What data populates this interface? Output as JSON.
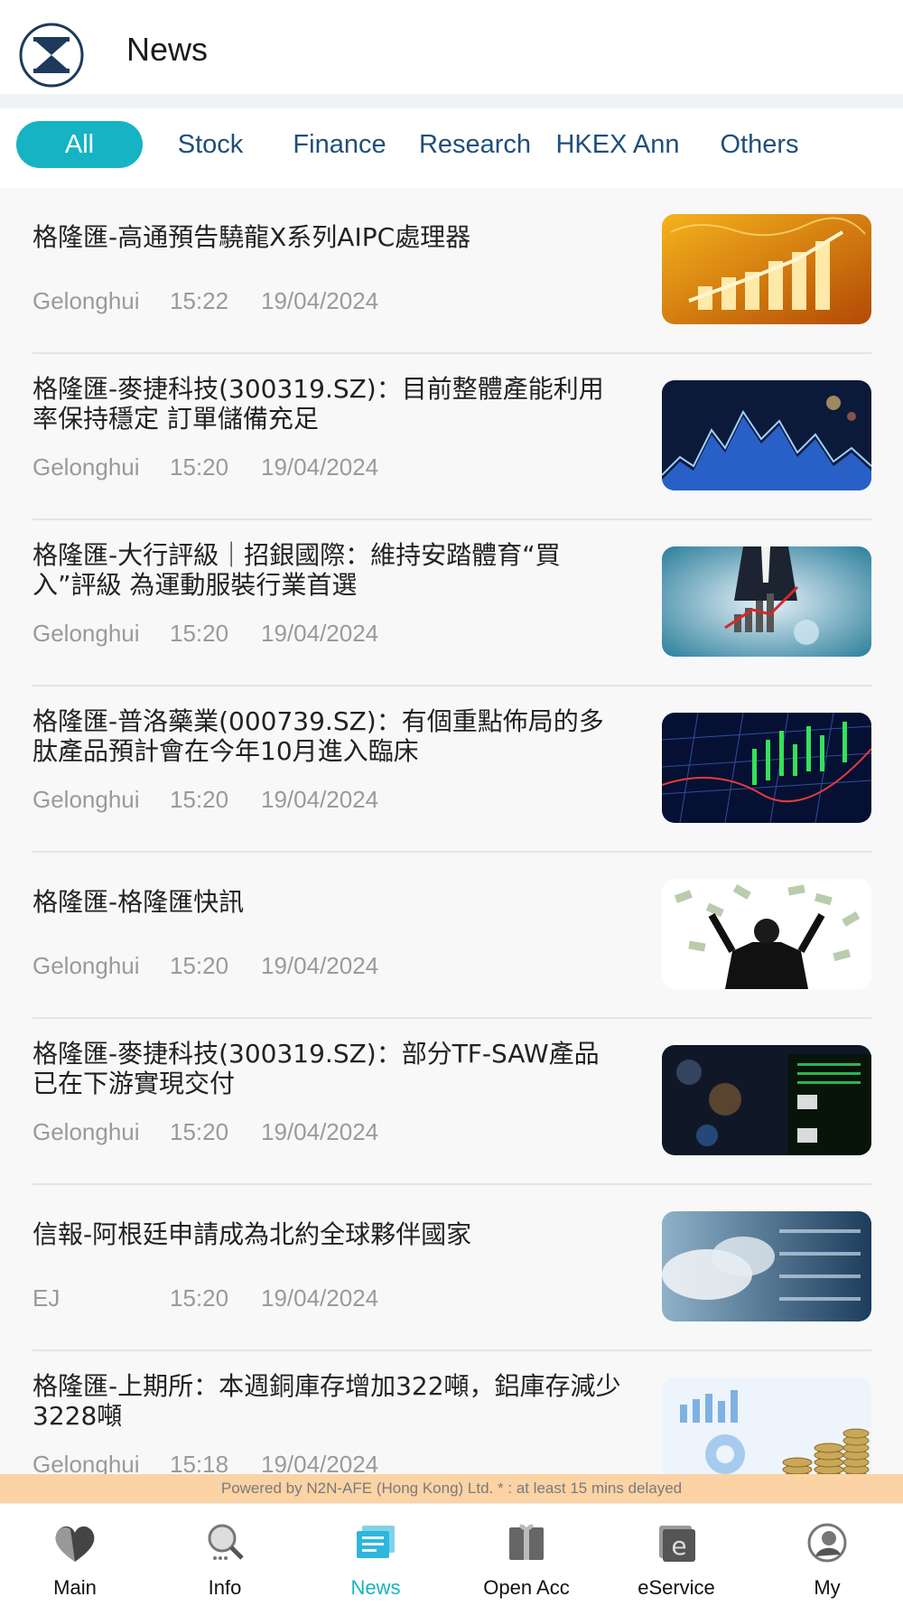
{
  "header": {
    "title": "News"
  },
  "tabs": [
    {
      "label": "All",
      "active": true
    },
    {
      "label": "Stock",
      "active": false
    },
    {
      "label": "Finance",
      "active": false
    },
    {
      "label": "Research",
      "active": false
    },
    {
      "label": "HKEX Ann",
      "active": false
    },
    {
      "label": "Others",
      "active": false
    }
  ],
  "news": [
    {
      "title": "格隆匯-高通預告驍龍X系列AIPC處理器",
      "source": "Gelonghui",
      "time": "15:22",
      "date": "19/04/2024",
      "image": "gold-bar-chart-world-map"
    },
    {
      "title": "格隆匯-麥捷科技(300319.SZ)：目前整體產能利用率保持穩定 訂單儲備充足",
      "source": "Gelonghui",
      "time": "15:20",
      "date": "19/04/2024",
      "image": "blue-stock-ticker-display"
    },
    {
      "title": "格隆匯-大行評級｜招銀國際：維持安踏體育“買入”評級 為運動服裝行業首選",
      "source": "Gelonghui",
      "time": "15:20",
      "date": "19/04/2024",
      "image": "businessman-growth-chart"
    },
    {
      "title": "格隆匯-普洛藥業(000739.SZ)：有個重點佈局的多肽產品預計會在今年10月進入臨床",
      "source": "Gelonghui",
      "time": "15:20",
      "date": "19/04/2024",
      "image": "candlestick-chart-grid"
    },
    {
      "title": "格隆匯-格隆匯快訊",
      "source": "Gelonghui",
      "time": "15:20",
      "date": "19/04/2024",
      "image": "man-with-flying-money"
    },
    {
      "title": "格隆匯-麥捷科技(300319.SZ)：部分TF-SAW產品已在下游實現交付",
      "source": "Gelonghui",
      "time": "15:20",
      "date": "19/04/2024",
      "image": "stock-board-bokeh"
    },
    {
      "title": "信報-阿根廷申請成為北約全球夥伴國家",
      "source": "EJ",
      "time": "15:20",
      "date": "19/04/2024",
      "image": "sky-with-stock-numbers"
    },
    {
      "title": "格隆匯-上期所：本週銅庫存增加322噸，鋁庫存減少3228噸",
      "source": "Gelonghui",
      "time": "15:18",
      "date": "19/04/2024",
      "image": "coins-and-charts"
    }
  ],
  "footer_note": "Powered by N2N-AFE (Hong Kong) Ltd. * : at least 15 mins delayed",
  "bottom_nav": [
    {
      "label": "Main",
      "icon": "heart-icon",
      "active": false
    },
    {
      "label": "Info",
      "icon": "magnifier-icon",
      "active": false
    },
    {
      "label": "News",
      "icon": "newspaper-icon",
      "active": true
    },
    {
      "label": "Open Acc",
      "icon": "gift-icon",
      "active": false
    },
    {
      "label": "eService",
      "icon": "e-letter-icon",
      "active": false
    },
    {
      "label": "My",
      "icon": "user-icon",
      "active": false
    }
  ],
  "colors": {
    "accent": "#15b3c3",
    "tab_text": "#1f4f7a",
    "footer_bg": "#fbd3a5",
    "list_bg": "#f8f8f8"
  }
}
